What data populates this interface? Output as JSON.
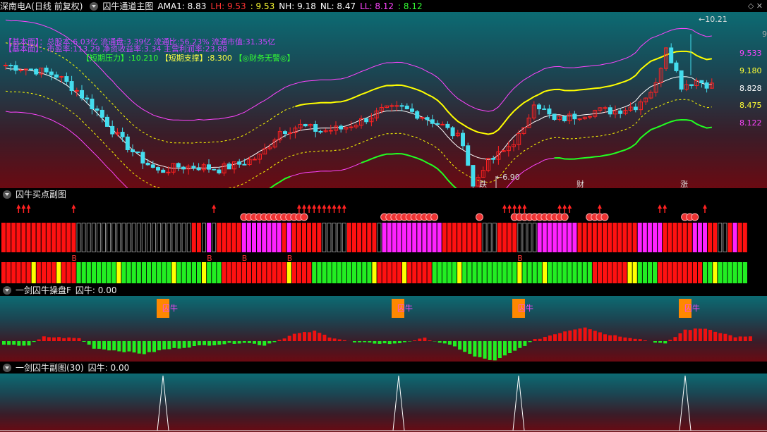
{
  "main": {
    "stock": "深南电A(日线 前复权)",
    "indicator": "囚牛通道主图",
    "values": [
      {
        "label": "AMA1: 8.83",
        "color": "#ffffff"
      },
      {
        "label": "LH: 9.53",
        "color": "#ff3333"
      },
      {
        "label": ": 9.53",
        "color": "#ffff33"
      },
      {
        "label": "NH: 9.18",
        "color": "#ffffff"
      },
      {
        "label": "NL: 8.47",
        "color": "#ffffff"
      },
      {
        "label": "LL: 8.12",
        "color": "#ff44ff"
      },
      {
        "label": ": 8.12",
        "color": "#33ff33"
      }
    ],
    "info_line1": "【基本面】：总股本:6.03亿 流通盘:3.39亿 流通比:56.23% 流通市值:31.35亿",
    "info_line2": "【基本面】：市盈率:113.29 净资收益率:3.34 主营利润率:23.88",
    "info_line3_short_press": "【短期压力】:10.210",
    "info_line3_short_support": "【短期支撑】:8.300",
    "info_line3_finance": "【◎财务无警◎】",
    "right_labels": [
      {
        "text": "9.533",
        "color": "#ff44ff"
      },
      {
        "text": "9.180",
        "color": "#ffff33"
      },
      {
        "text": "8.828",
        "color": "#ffffff"
      },
      {
        "text": "8.475",
        "color": "#ffff33"
      },
      {
        "text": "8.122",
        "color": "#ff44ff"
      }
    ],
    "right_edge": "9",
    "high_mark": "10.21",
    "low_mark": "6.90",
    "bottom_marks": [
      {
        "text": "跌",
        "color": "#33ff33"
      },
      {
        "text": "财",
        "color": "#ffffff"
      },
      {
        "text": "涨",
        "color": "#ff5555"
      }
    ]
  },
  "panel2": {
    "title": "囚牛买点副图",
    "b_label": "B"
  },
  "panel3": {
    "title": "一剑囚牛操盘F",
    "value": "囚牛: 0.00",
    "tag": "囚牛"
  },
  "panel4": {
    "title": "一剑囚牛副图(30)",
    "value": "囚牛: 0.00"
  },
  "colors": {
    "up": "#ff2222",
    "down": "#44ddee",
    "green": "#22ff22",
    "magenta": "#ff22ff",
    "yellow": "#ffff00"
  }
}
